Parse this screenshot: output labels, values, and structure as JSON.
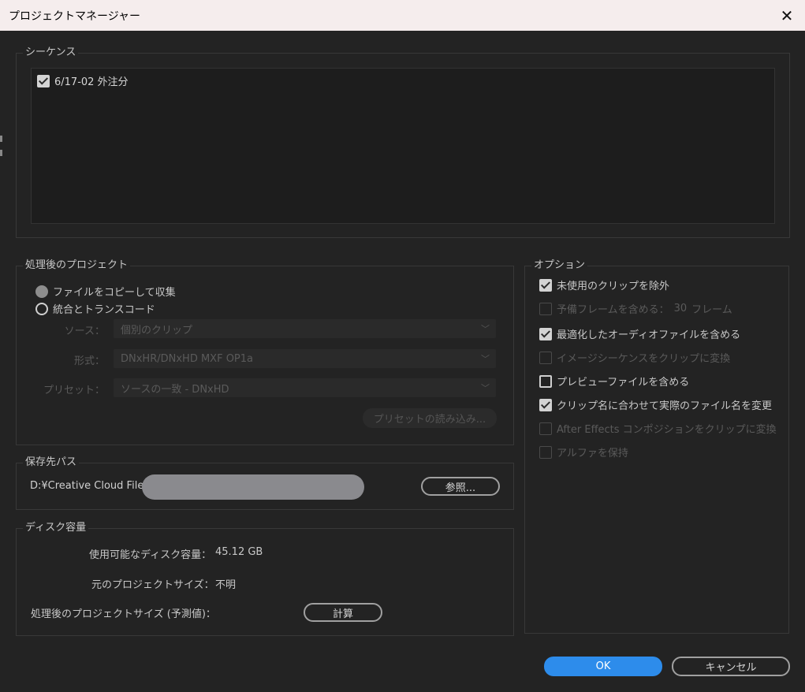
{
  "window": {
    "title": "プロジェクトマネージャー"
  },
  "sequences": {
    "label": "シーケンス",
    "items": [
      {
        "label": "6/17-02 外注分",
        "checked": true
      }
    ]
  },
  "processed_project": {
    "label": "処理後のプロジェクト",
    "radio_collect": "ファイルをコピーして収集",
    "radio_consolidate": "統合とトランスコード",
    "source_label": "ソース：",
    "source_value": "個別のクリップ",
    "format_label": "形式：",
    "format_value": "DNxHR/DNxHD MXF OP1a",
    "preset_label": "プリセット：",
    "preset_value": "ソースの一致 - DNxHD",
    "import_preset_button": "プリセットの読み込み..."
  },
  "destination": {
    "label": "保存先パス",
    "path": "D:¥Creative Cloud Files",
    "browse_button": "参照..."
  },
  "disk": {
    "label": "ディスク容量",
    "available_label": "使用可能なディスク容量：",
    "available_value": "45.12 GB",
    "original_label": "元のプロジェクトサイズ：",
    "original_value": "不明",
    "processed_label": "処理後のプロジェクトサイズ (予測値)：",
    "calc_button": "計算"
  },
  "options": {
    "label": "オプション",
    "exclude_unused": {
      "label": "未使用のクリップを除外",
      "checked": true,
      "enabled": true
    },
    "handles": {
      "label": "予備フレームを含める：",
      "value": "30",
      "unit": "フレーム",
      "checked": false,
      "enabled": false
    },
    "include_audio": {
      "label": "最適化したオーディオファイルを含める",
      "checked": true,
      "enabled": true
    },
    "image_seq": {
      "label": "イメージシーケンスをクリップに変換",
      "checked": false,
      "enabled": false
    },
    "include_preview": {
      "label": "プレビューファイルを含める",
      "checked": false,
      "enabled": true
    },
    "rename_files": {
      "label": "クリップ名に合わせて実際のファイル名を変更",
      "checked": true,
      "enabled": true
    },
    "ae_comp": {
      "label": "After Effects コンポジションをクリップに変換",
      "checked": false,
      "enabled": false
    },
    "alpha": {
      "label": "アルファを保持",
      "checked": false,
      "enabled": false
    }
  },
  "footer": {
    "ok": "OK",
    "cancel": "キャンセル"
  },
  "colors": {
    "accent": "#2d8ceb",
    "background": "#232323",
    "title_bar": "#f5eded"
  }
}
